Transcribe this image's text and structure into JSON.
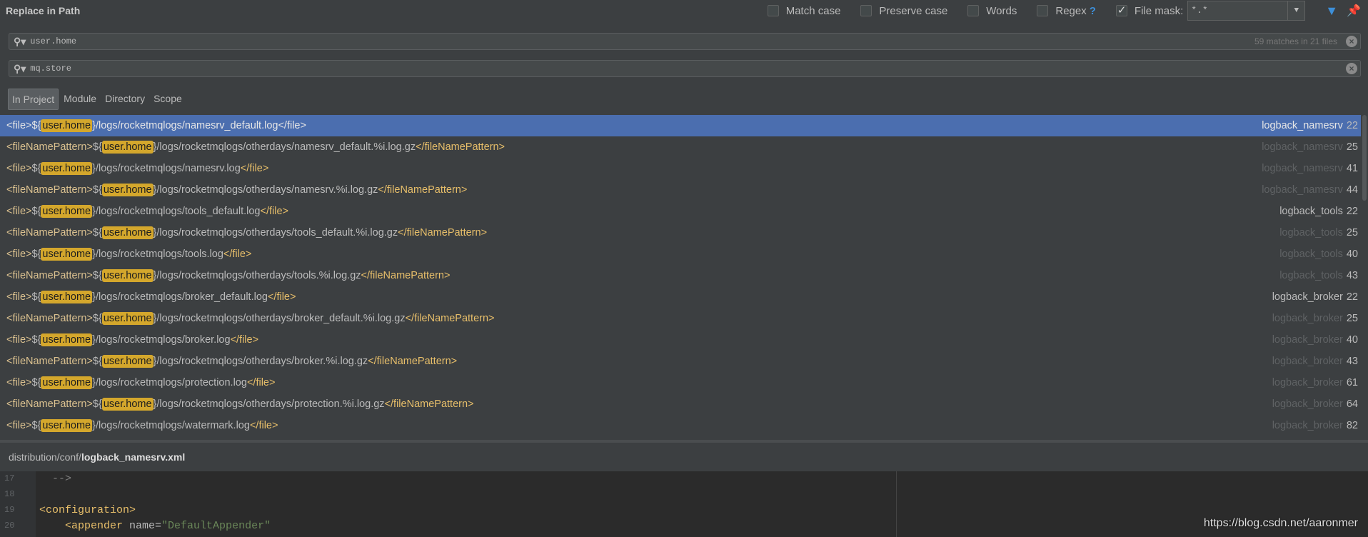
{
  "title": "Replace in Path",
  "options": [
    {
      "label": "Match case",
      "checked": false
    },
    {
      "label": "Preserve case",
      "checked": false
    },
    {
      "label": "Words",
      "checked": false
    },
    {
      "label": "Regex",
      "checked": false,
      "help": "?"
    },
    {
      "label": "File mask:",
      "checked": true
    }
  ],
  "file_mask": "*.*",
  "search": {
    "value": "user.home",
    "count": "59 matches in 21 files"
  },
  "replace": {
    "value": "mq.store"
  },
  "tabs": [
    "In Project",
    "Module",
    "Directory",
    "Scope"
  ],
  "results": [
    {
      "open": "<file>",
      "pre": "${",
      "match": "user.home",
      "post": "}/logs/rocketmqlogs/namesrv_default.log",
      "close": "</file>",
      "file": "logback_namesrv",
      "line": "22",
      "first": true
    },
    {
      "open": "<fileNamePattern>",
      "pre": "${",
      "match": "user.home",
      "post": "}/logs/rocketmqlogs/otherdays/namesrv_default.%i.log.gz",
      "close": "</fileNamePattern>",
      "file": "logback_namesrv",
      "line": "25",
      "first": false
    },
    {
      "open": "<file>",
      "pre": "${",
      "match": "user.home",
      "post": "}/logs/rocketmqlogs/namesrv.log",
      "close": "</file>",
      "file": "logback_namesrv",
      "line": "41",
      "first": false
    },
    {
      "open": "<fileNamePattern>",
      "pre": "${",
      "match": "user.home",
      "post": "}/logs/rocketmqlogs/otherdays/namesrv.%i.log.gz",
      "close": "</fileNamePattern>",
      "file": "logback_namesrv",
      "line": "44",
      "first": false
    },
    {
      "open": "<file>",
      "pre": "${",
      "match": "user.home",
      "post": "}/logs/rocketmqlogs/tools_default.log",
      "close": "</file>",
      "file": "logback_tools",
      "line": "22",
      "first": true
    },
    {
      "open": "<fileNamePattern>",
      "pre": "${",
      "match": "user.home",
      "post": "}/logs/rocketmqlogs/otherdays/tools_default.%i.log.gz",
      "close": "</fileNamePattern>",
      "file": "logback_tools",
      "line": "25",
      "first": false
    },
    {
      "open": "<file>",
      "pre": "${",
      "match": "user.home",
      "post": "}/logs/rocketmqlogs/tools.log",
      "close": "</file>",
      "file": "logback_tools",
      "line": "40",
      "first": false
    },
    {
      "open": "<fileNamePattern>",
      "pre": "${",
      "match": "user.home",
      "post": "}/logs/rocketmqlogs/otherdays/tools.%i.log.gz",
      "close": "</fileNamePattern>",
      "file": "logback_tools",
      "line": "43",
      "first": false
    },
    {
      "open": "<file>",
      "pre": "${",
      "match": "user.home",
      "post": "}/logs/rocketmqlogs/broker_default.log",
      "close": "</file>",
      "file": "logback_broker",
      "line": "22",
      "first": true
    },
    {
      "open": "<fileNamePattern>",
      "pre": "${",
      "match": "user.home",
      "post": "}/logs/rocketmqlogs/otherdays/broker_default.%i.log.gz",
      "close": "</fileNamePattern>",
      "file": "logback_broker",
      "line": "25",
      "first": false
    },
    {
      "open": "<file>",
      "pre": "${",
      "match": "user.home",
      "post": "}/logs/rocketmqlogs/broker.log",
      "close": "</file>",
      "file": "logback_broker",
      "line": "40",
      "first": false
    },
    {
      "open": "<fileNamePattern>",
      "pre": "${",
      "match": "user.home",
      "post": "}/logs/rocketmqlogs/otherdays/broker.%i.log.gz",
      "close": "</fileNamePattern>",
      "file": "logback_broker",
      "line": "43",
      "first": false
    },
    {
      "open": "<file>",
      "pre": "${",
      "match": "user.home",
      "post": "}/logs/rocketmqlogs/protection.log",
      "close": "</file>",
      "file": "logback_broker",
      "line": "61",
      "first": false
    },
    {
      "open": "<fileNamePattern>",
      "pre": "${",
      "match": "user.home",
      "post": "}/logs/rocketmqlogs/otherdays/protection.%i.log.gz",
      "close": "</fileNamePattern>",
      "file": "logback_broker",
      "line": "64",
      "first": false
    },
    {
      "open": "<file>",
      "pre": "${",
      "match": "user.home",
      "post": "}/logs/rocketmqlogs/watermark.log",
      "close": "</file>",
      "file": "logback_broker",
      "line": "82",
      "first": false
    }
  ],
  "preview": {
    "path_dir": "distribution/conf/",
    "path_file": "logback_namesrv.xml",
    "lines": [
      {
        "num": "17",
        "parts": [
          {
            "t": "  -->",
            "c": "ecom"
          }
        ]
      },
      {
        "num": "18",
        "parts": []
      },
      {
        "num": "19",
        "parts": [
          {
            "t": "<configuration>",
            "c": "etag"
          }
        ]
      },
      {
        "num": "20",
        "parts": [
          {
            "t": "    <appender ",
            "c": "etag"
          },
          {
            "t": "name=",
            "c": "eattr"
          },
          {
            "t": "\"DefaultAppender\"",
            "c": "eval"
          }
        ]
      }
    ]
  },
  "watermark": "https://blog.csdn.net/aaronmer"
}
